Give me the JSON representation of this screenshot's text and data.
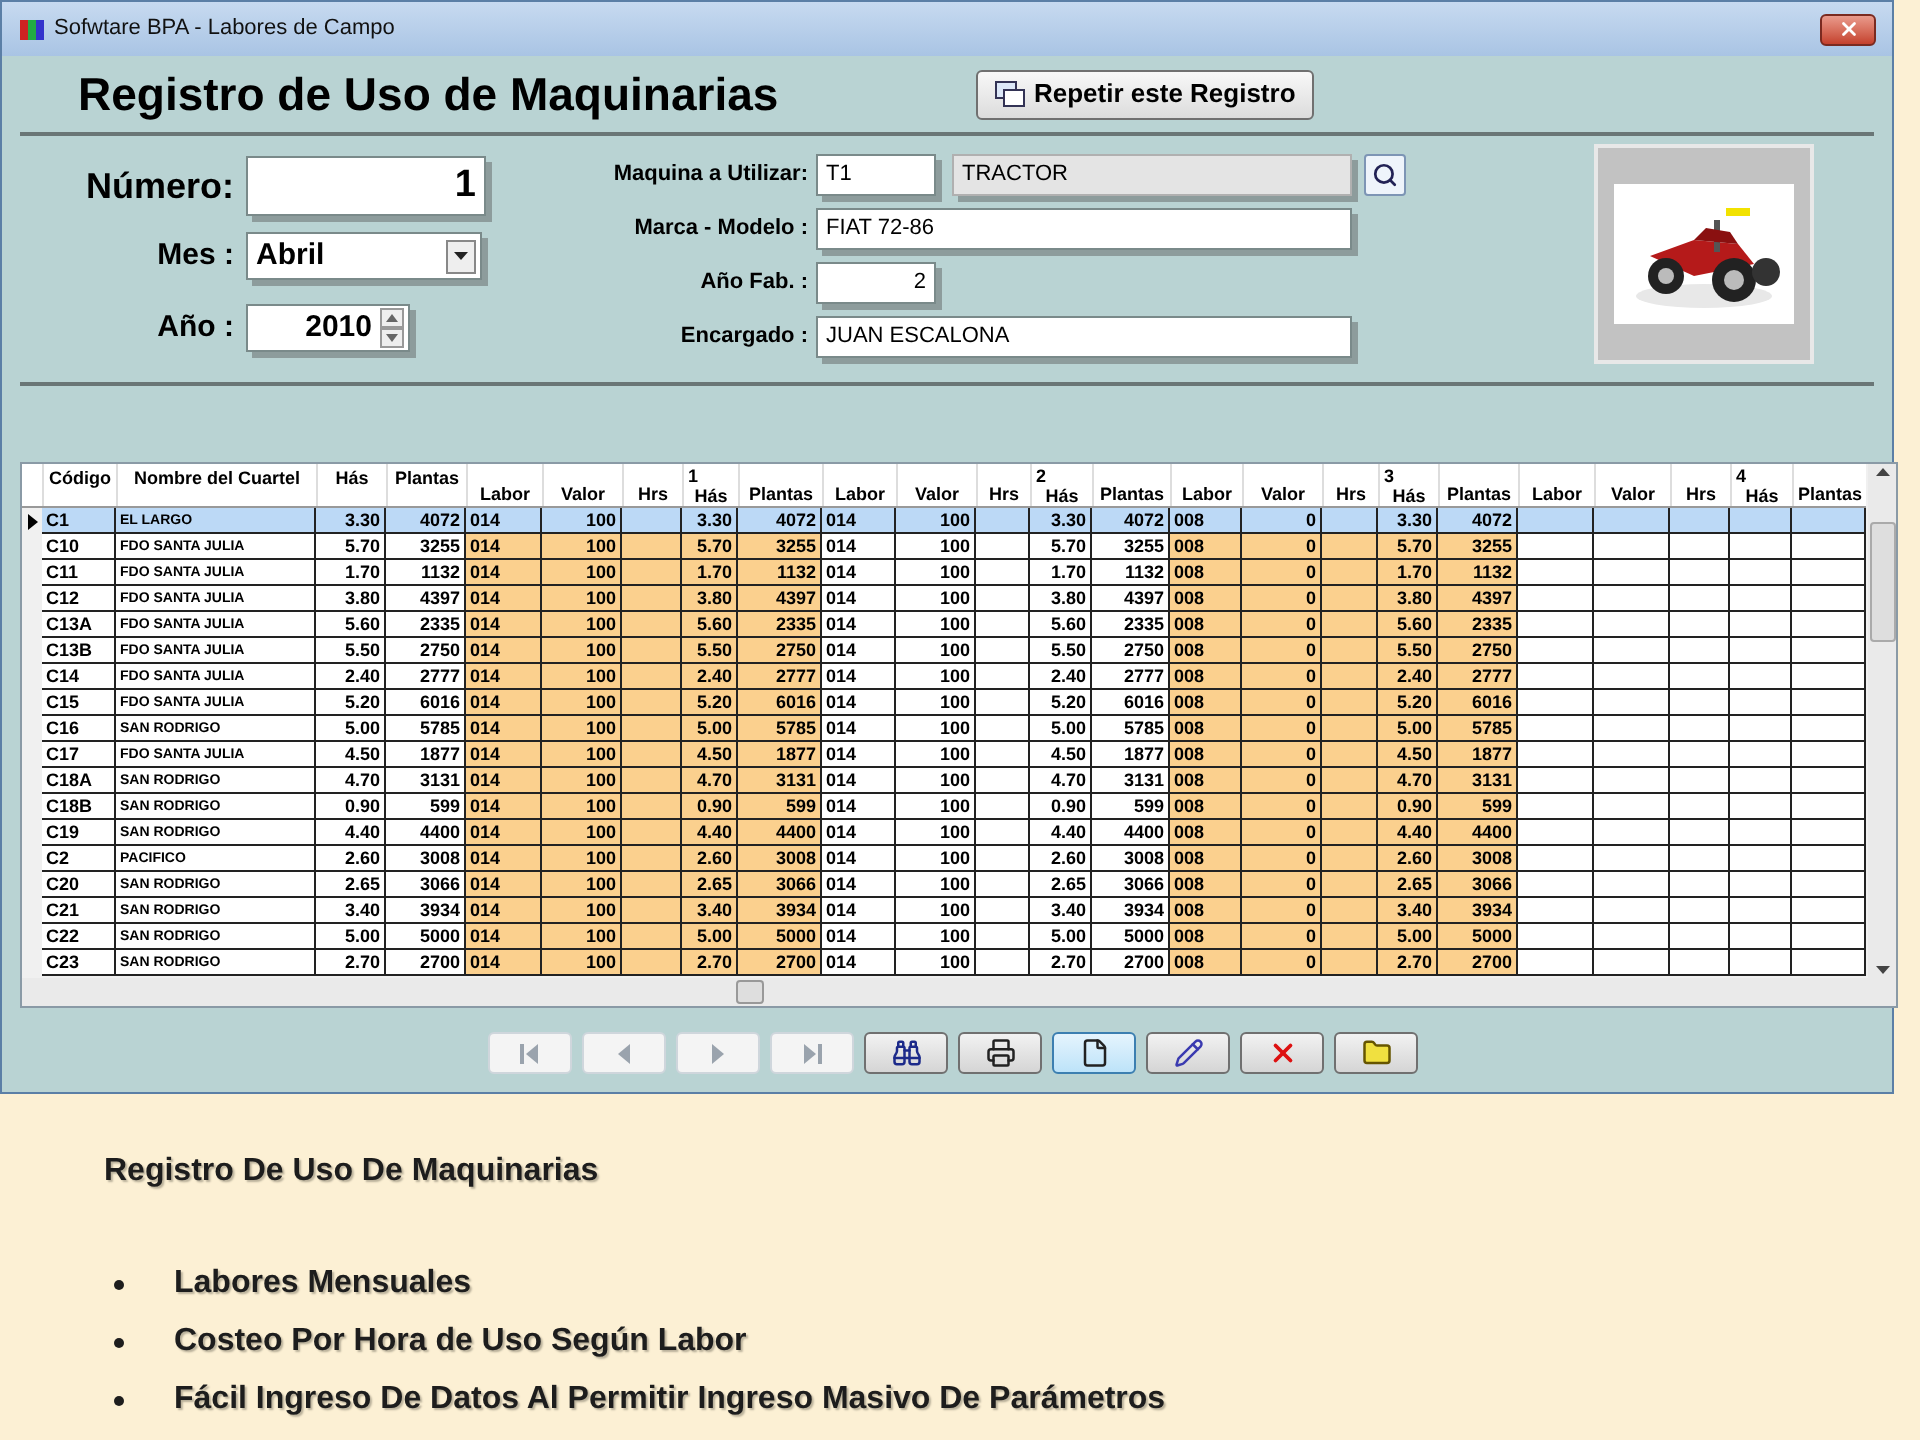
{
  "window": {
    "title": "Sofwtare BPA - Labores de Campo"
  },
  "form": {
    "title": "Registro de Uso de Maquinarias",
    "repeat_button": "Repetir este Registro",
    "numero": {
      "label": "Número:",
      "value": "1"
    },
    "mes": {
      "label": "Mes :",
      "value": "Abril"
    },
    "anio": {
      "label": "Año :",
      "value": "2010"
    },
    "maquina": {
      "label": "Maquina a Utilizar:",
      "code": "T1",
      "name": "TRACTOR"
    },
    "marca": {
      "label": "Marca - Modelo :",
      "value": "FIAT 72-86"
    },
    "anio_fab": {
      "label": "Año Fab. :",
      "value": "2"
    },
    "encargado": {
      "label": "Encargado :",
      "value": "JUAN ESCALONA"
    }
  },
  "table": {
    "columns": [
      {
        "label": "Código",
        "kind": "text",
        "shaded": false
      },
      {
        "label": "Nombre del Cuartel",
        "kind": "text",
        "shaded": false
      },
      {
        "label": "Hás",
        "kind": "number",
        "shaded": false
      },
      {
        "label": "Plantas",
        "kind": "number",
        "shaded": false
      },
      {
        "label": "Labor",
        "kind": "text",
        "shaded": true
      },
      {
        "label": "Valor",
        "kind": "number",
        "shaded": true
      },
      {
        "label": "Hrs",
        "kind": "number",
        "shaded": true
      },
      {
        "group": "1",
        "label": "Hás",
        "kind": "number",
        "shaded": true
      },
      {
        "label": "Plantas",
        "kind": "number",
        "shaded": true
      },
      {
        "label": "Labor",
        "kind": "text",
        "shaded": false
      },
      {
        "label": "Valor",
        "kind": "number",
        "shaded": false
      },
      {
        "label": "Hrs",
        "kind": "number",
        "shaded": false
      },
      {
        "group": "2",
        "label": "Hás",
        "kind": "number",
        "shaded": false
      },
      {
        "label": "Plantas",
        "kind": "number",
        "shaded": false
      },
      {
        "label": "Labor",
        "kind": "text",
        "shaded": true
      },
      {
        "label": "Valor",
        "kind": "number",
        "shaded": true
      },
      {
        "label": "Hrs",
        "kind": "number",
        "shaded": true
      },
      {
        "group": "3",
        "label": "Hás",
        "kind": "number",
        "shaded": true
      },
      {
        "label": "Plantas",
        "kind": "number",
        "shaded": true
      },
      {
        "label": "Labor",
        "kind": "text",
        "shaded": false
      },
      {
        "label": "Valor",
        "kind": "number",
        "shaded": false
      },
      {
        "label": "Hrs",
        "kind": "number",
        "shaded": false
      },
      {
        "group": "4",
        "label": "Hás",
        "kind": "number",
        "shaded": false
      },
      {
        "label": "Plantas",
        "kind": "number",
        "shaded": false
      }
    ],
    "rows": [
      {
        "selected": true,
        "cells": [
          "C1",
          "EL LARGO",
          "3.30",
          "4072",
          "014",
          "100",
          null,
          "3.30",
          "4072",
          "014",
          "100",
          null,
          "3.30",
          "4072",
          "008",
          "0",
          null,
          "3.30",
          "4072",
          null,
          null,
          null,
          null,
          null
        ]
      },
      {
        "selected": false,
        "cells": [
          "C10",
          "FDO SANTA JULIA",
          "5.70",
          "3255",
          "014",
          "100",
          null,
          "5.70",
          "3255",
          "014",
          "100",
          null,
          "5.70",
          "3255",
          "008",
          "0",
          null,
          "5.70",
          "3255",
          null,
          null,
          null,
          null,
          null
        ]
      },
      {
        "selected": false,
        "cells": [
          "C11",
          "FDO SANTA JULIA",
          "1.70",
          "1132",
          "014",
          "100",
          null,
          "1.70",
          "1132",
          "014",
          "100",
          null,
          "1.70",
          "1132",
          "008",
          "0",
          null,
          "1.70",
          "1132",
          null,
          null,
          null,
          null,
          null
        ]
      },
      {
        "selected": false,
        "cells": [
          "C12",
          "FDO SANTA JULIA",
          "3.80",
          "4397",
          "014",
          "100",
          null,
          "3.80",
          "4397",
          "014",
          "100",
          null,
          "3.80",
          "4397",
          "008",
          "0",
          null,
          "3.80",
          "4397",
          null,
          null,
          null,
          null,
          null
        ]
      },
      {
        "selected": false,
        "cells": [
          "C13A",
          "FDO SANTA JULIA",
          "5.60",
          "2335",
          "014",
          "100",
          null,
          "5.60",
          "2335",
          "014",
          "100",
          null,
          "5.60",
          "2335",
          "008",
          "0",
          null,
          "5.60",
          "2335",
          null,
          null,
          null,
          null,
          null
        ]
      },
      {
        "selected": false,
        "cells": [
          "C13B",
          "FDO SANTA JULIA",
          "5.50",
          "2750",
          "014",
          "100",
          null,
          "5.50",
          "2750",
          "014",
          "100",
          null,
          "5.50",
          "2750",
          "008",
          "0",
          null,
          "5.50",
          "2750",
          null,
          null,
          null,
          null,
          null
        ]
      },
      {
        "selected": false,
        "cells": [
          "C14",
          "FDO SANTA JULIA",
          "2.40",
          "2777",
          "014",
          "100",
          null,
          "2.40",
          "2777",
          "014",
          "100",
          null,
          "2.40",
          "2777",
          "008",
          "0",
          null,
          "2.40",
          "2777",
          null,
          null,
          null,
          null,
          null
        ]
      },
      {
        "selected": false,
        "cells": [
          "C15",
          "FDO SANTA JULIA",
          "5.20",
          "6016",
          "014",
          "100",
          null,
          "5.20",
          "6016",
          "014",
          "100",
          null,
          "5.20",
          "6016",
          "008",
          "0",
          null,
          "5.20",
          "6016",
          null,
          null,
          null,
          null,
          null
        ]
      },
      {
        "selected": false,
        "cells": [
          "C16",
          "SAN RODRIGO",
          "5.00",
          "5785",
          "014",
          "100",
          null,
          "5.00",
          "5785",
          "014",
          "100",
          null,
          "5.00",
          "5785",
          "008",
          "0",
          null,
          "5.00",
          "5785",
          null,
          null,
          null,
          null,
          null
        ]
      },
      {
        "selected": false,
        "cells": [
          "C17",
          "FDO SANTA JULIA",
          "4.50",
          "1877",
          "014",
          "100",
          null,
          "4.50",
          "1877",
          "014",
          "100",
          null,
          "4.50",
          "1877",
          "008",
          "0",
          null,
          "4.50",
          "1877",
          null,
          null,
          null,
          null,
          null
        ]
      },
      {
        "selected": false,
        "cells": [
          "C18A",
          "SAN RODRIGO",
          "4.70",
          "3131",
          "014",
          "100",
          null,
          "4.70",
          "3131",
          "014",
          "100",
          null,
          "4.70",
          "3131",
          "008",
          "0",
          null,
          "4.70",
          "3131",
          null,
          null,
          null,
          null,
          null
        ]
      },
      {
        "selected": false,
        "cells": [
          "C18B",
          "SAN RODRIGO",
          "0.90",
          "599",
          "014",
          "100",
          null,
          "0.90",
          "599",
          "014",
          "100",
          null,
          "0.90",
          "599",
          "008",
          "0",
          null,
          "0.90",
          "599",
          null,
          null,
          null,
          null,
          null
        ]
      },
      {
        "selected": false,
        "cells": [
          "C19",
          "SAN RODRIGO",
          "4.40",
          "4400",
          "014",
          "100",
          null,
          "4.40",
          "4400",
          "014",
          "100",
          null,
          "4.40",
          "4400",
          "008",
          "0",
          null,
          "4.40",
          "4400",
          null,
          null,
          null,
          null,
          null
        ]
      },
      {
        "selected": false,
        "cells": [
          "C2",
          "PACIFICO",
          "2.60",
          "3008",
          "014",
          "100",
          null,
          "2.60",
          "3008",
          "014",
          "100",
          null,
          "2.60",
          "3008",
          "008",
          "0",
          null,
          "2.60",
          "3008",
          null,
          null,
          null,
          null,
          null
        ]
      },
      {
        "selected": false,
        "cells": [
          "C20",
          "SAN RODRIGO",
          "2.65",
          "3066",
          "014",
          "100",
          null,
          "2.65",
          "3066",
          "014",
          "100",
          null,
          "2.65",
          "3066",
          "008",
          "0",
          null,
          "2.65",
          "3066",
          null,
          null,
          null,
          null,
          null
        ]
      },
      {
        "selected": false,
        "cells": [
          "C21",
          "SAN RODRIGO",
          "3.40",
          "3934",
          "014",
          "100",
          null,
          "3.40",
          "3934",
          "014",
          "100",
          null,
          "3.40",
          "3934",
          "008",
          "0",
          null,
          "3.40",
          "3934",
          null,
          null,
          null,
          null,
          null
        ]
      },
      {
        "selected": false,
        "cells": [
          "C22",
          "SAN RODRIGO",
          "5.00",
          "5000",
          "014",
          "100",
          null,
          "5.00",
          "5000",
          "014",
          "100",
          null,
          "5.00",
          "5000",
          "008",
          "0",
          null,
          "5.00",
          "5000",
          null,
          null,
          null,
          null,
          null
        ]
      },
      {
        "selected": false,
        "cells": [
          "C23",
          "SAN RODRIGO",
          "2.70",
          "2700",
          "014",
          "100",
          null,
          "2.70",
          "2700",
          "014",
          "100",
          null,
          "2.70",
          "2700",
          "008",
          "0",
          null,
          "2.70",
          "2700",
          null,
          null,
          null,
          null,
          null
        ]
      }
    ]
  },
  "toolbar": [
    {
      "kind": "first",
      "disabled": true,
      "selected": false
    },
    {
      "kind": "prev",
      "disabled": true,
      "selected": false
    },
    {
      "kind": "next",
      "disabled": true,
      "selected": false
    },
    {
      "kind": "last",
      "disabled": true,
      "selected": false
    },
    {
      "kind": "find",
      "disabled": false,
      "selected": false
    },
    {
      "kind": "print",
      "disabled": false,
      "selected": false
    },
    {
      "kind": "new",
      "disabled": false,
      "selected": true
    },
    {
      "kind": "edit",
      "disabled": false,
      "selected": false
    },
    {
      "kind": "delete",
      "disabled": false,
      "selected": false
    },
    {
      "kind": "folder",
      "disabled": false,
      "selected": false
    }
  ],
  "caption": {
    "title": "Registro De Uso De Maquinarias",
    "bullets": [
      "Labores Mensuales",
      "Costeo Por Hora de Uso Según Labor",
      "Fácil Ingreso De Datos Al Permitir Ingreso Masivo De Parámetros"
    ]
  }
}
